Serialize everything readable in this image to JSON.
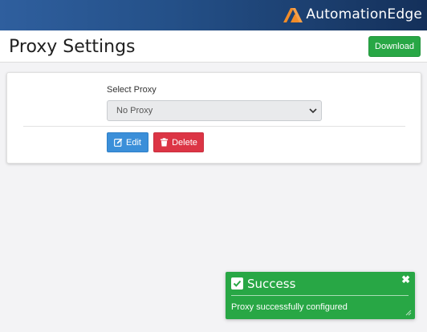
{
  "brand": {
    "name": "AutomationEdge"
  },
  "header": {
    "title": "Proxy Settings",
    "download_label": "Download"
  },
  "form": {
    "select_label": "Select Proxy",
    "select_value": "No Proxy",
    "edit_label": "Edit",
    "delete_label": "Delete"
  },
  "toast": {
    "title": "Success",
    "message": "Proxy successfully configured",
    "close_glyph": "✖"
  },
  "colors": {
    "success": "#28a745",
    "danger": "#dc3545",
    "primary": "#3b8fd9",
    "brand_orange": "#f28c28"
  }
}
